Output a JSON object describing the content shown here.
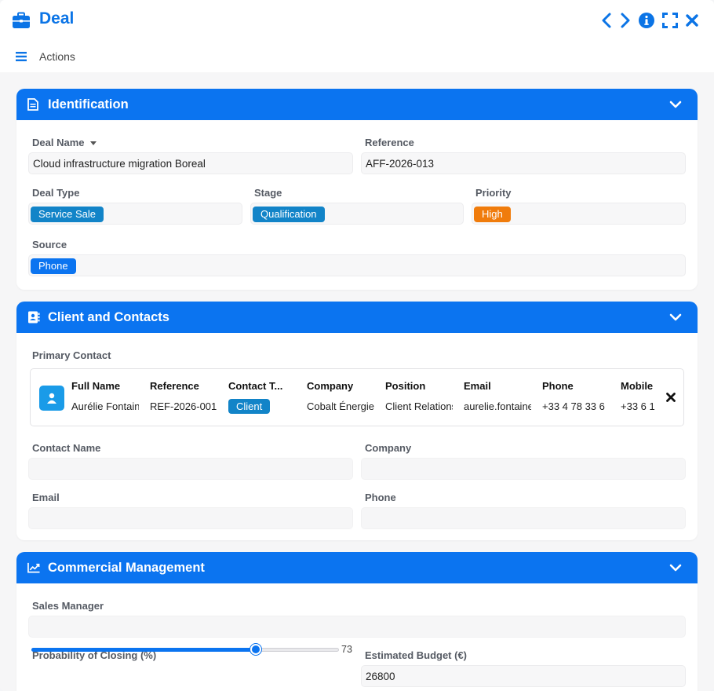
{
  "window": {
    "title": "Deal",
    "actions_label": "Actions"
  },
  "colors": {
    "accent": "#0b74f0",
    "teal": "#1284c8",
    "orange": "#f07c0c"
  },
  "identification": {
    "title": "Identification",
    "deal_name_label": "Deal Name",
    "deal_name_value": "Cloud infrastructure migration Boreal",
    "reference_label": "Reference",
    "reference_value": "AFF-2026-013",
    "deal_type_label": "Deal Type",
    "deal_type_value": "Service Sale",
    "stage_label": "Stage",
    "stage_value": "Qualification",
    "priority_label": "Priority",
    "priority_value": "High",
    "source_label": "Source",
    "source_value": "Phone"
  },
  "client": {
    "title": "Client and Contacts",
    "primary_contact_label": "Primary Contact",
    "contact_card": {
      "headers": [
        "Full Name",
        "Reference",
        "Contact T...",
        "Company",
        "Position",
        "Email",
        "Phone",
        "Mobile"
      ],
      "values": [
        "Aurélie Fontaine",
        "REF-2026-001",
        "Client",
        "Cobalt Énergie",
        "Client Relations",
        "aurelie.fontaine",
        "+33 4 78 33 6",
        "+33 6 1"
      ]
    },
    "contact_name_label": "Contact Name",
    "company_label": "Company",
    "email_label": "Email",
    "phone_label": "Phone"
  },
  "commercial": {
    "title": "Commercial Management",
    "sales_manager_label": "Sales Manager",
    "probability_label": "Probability of Closing (%)",
    "probability_value": 73,
    "probability_display": "73",
    "budget_label": "Estimated Budget (€)",
    "budget_value": "26800"
  }
}
